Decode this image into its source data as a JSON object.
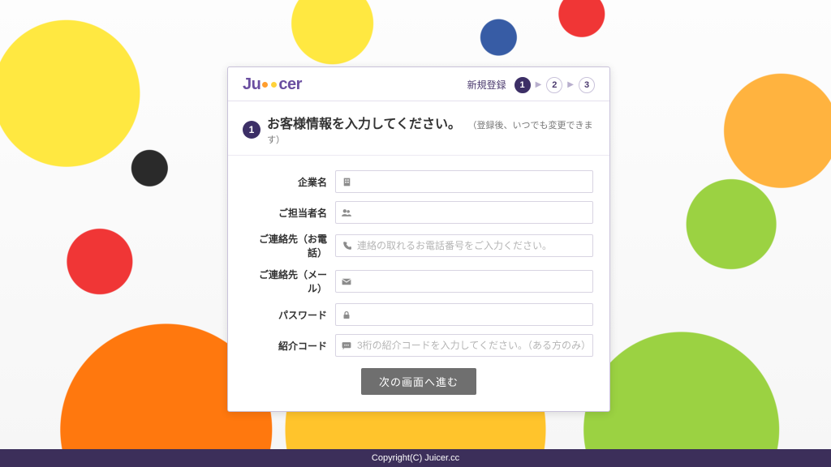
{
  "logo_text_left": "Ju",
  "logo_text_right": "cer",
  "steps_label": "新規登録",
  "steps": [
    "1",
    "2",
    "3"
  ],
  "active_step": "1",
  "title_badge": "1",
  "title": "お客様情報を入力してください。",
  "title_sub": "（登録後、いつでも変更できます）",
  "fields": {
    "company": {
      "label": "企業名",
      "placeholder": ""
    },
    "contact": {
      "label": "ご担当者名",
      "placeholder": ""
    },
    "phone": {
      "label": "ご連絡先（お電話）",
      "placeholder": "連絡の取れるお電話番号をご入力ください。"
    },
    "email": {
      "label": "ご連絡先（メール）",
      "placeholder": ""
    },
    "password": {
      "label": "パスワード",
      "placeholder": ""
    },
    "referral": {
      "label": "紹介コード",
      "placeholder": "3桁の紹介コードを入力してください。（ある方のみ）"
    }
  },
  "submit_label": "次の画面へ進む",
  "footer": "Copyright(C) Juicer.cc"
}
